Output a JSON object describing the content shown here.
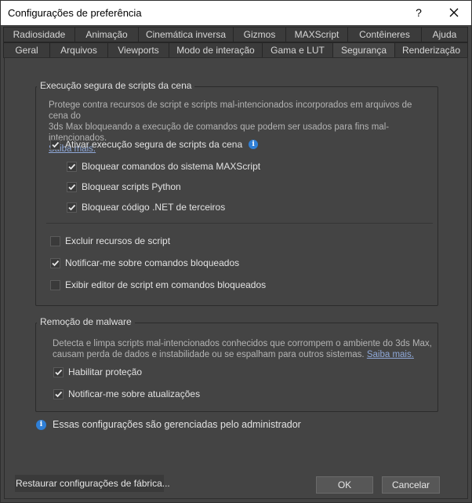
{
  "window": {
    "title": "Configurações de preferência",
    "help_label": "?"
  },
  "tabs_row1": [
    "Radiosidade",
    "Animação",
    "Cinemática inversa",
    "Gizmos",
    "MAXScript",
    "Contêineres",
    "Ajuda"
  ],
  "tabs_row2": [
    "Geral",
    "Arquivos",
    "Viewports",
    "Modo de interação",
    "Gama e LUT",
    "Segurança",
    "Renderização"
  ],
  "active_tab": "Segurança",
  "safe_scene": {
    "title": "Execução segura de scripts da cena",
    "description_line1": "Protege contra recursos de script e scripts mal-intencionados incorporados em arquivos de cena do",
    "description_line2": "3ds Max bloqueando a execução de comandos que podem ser usados para fins mal-intencionados.",
    "learn_more": "Saiba mais.",
    "enable": {
      "label": "Ativar execução segura de scripts da cena",
      "checked": true
    },
    "block_maxscript": {
      "label": "Bloquear comandos do sistema MAXScript",
      "checked": true
    },
    "block_python": {
      "label": "Bloquear scripts Python",
      "checked": true
    },
    "block_dotnet": {
      "label": "Bloquear código .NET de terceiros",
      "checked": true
    },
    "exclude_resources": {
      "label": "Excluir recursos de script",
      "checked": false
    },
    "notify_blocked": {
      "label": "Notificar-me sobre comandos bloqueados",
      "checked": true
    },
    "show_editor": {
      "label": "Exibir editor de script em comandos bloqueados",
      "checked": false
    }
  },
  "malware": {
    "title": "Remoção de malware",
    "description_line1": "Detecta e limpa scripts mal-intencionados conhecidos que corrompem o ambiente do 3ds Max,",
    "description_line2": "causam perda de dados e instabilidade ou se espalham para outros sistemas.",
    "learn_more": "Saiba mais.",
    "enable_protection": {
      "label": "Habilitar proteção",
      "checked": true
    },
    "notify_updates": {
      "label": "Notificar-me sobre atualizações",
      "checked": true
    }
  },
  "admin_note": "Essas configurações são gerenciadas pelo administrador",
  "buttons": {
    "restore": "Restaurar configurações de fábrica...",
    "ok": "OK",
    "cancel": "Cancelar"
  },
  "colors": {
    "background": "#444444",
    "link": "#8fa8d8",
    "info_icon": "#2f7fd6"
  }
}
